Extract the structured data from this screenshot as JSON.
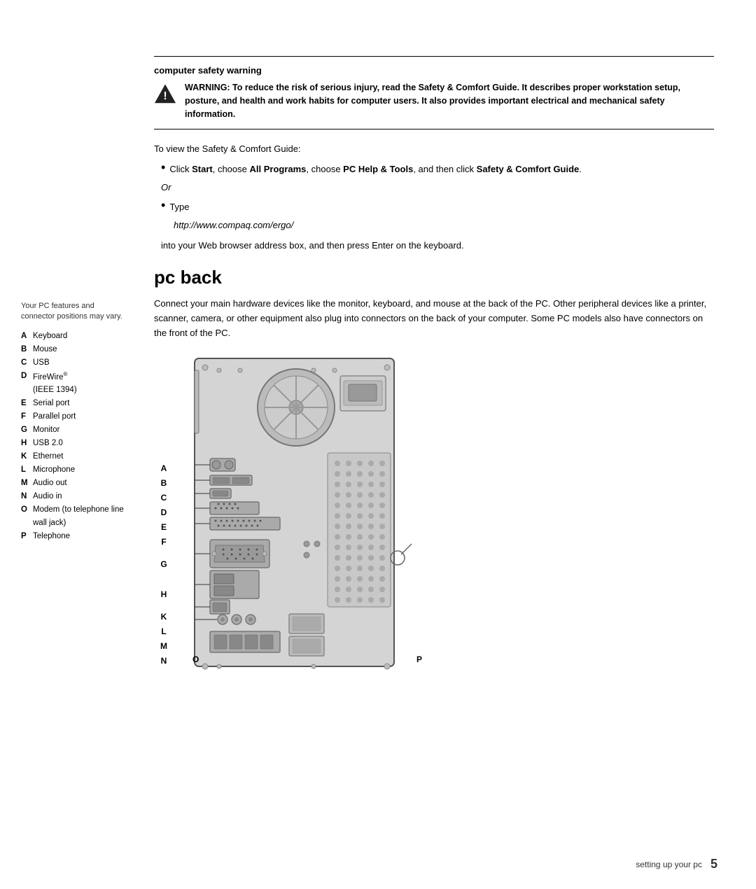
{
  "page": {
    "footer_text": "setting up your pc",
    "page_number": "5"
  },
  "warning": {
    "title": "computer safety warning",
    "icon_alt": "warning-triangle",
    "text": "WARNING: To reduce the risk of serious injury, read the Safety & Comfort Guide. It describes proper workstation setup, posture, and health and work habits for computer users. It also provides important electrical and mechanical safety information."
  },
  "safety_guide": {
    "intro": "To view the Safety & Comfort Guide:",
    "bullet1_prefix": "Click ",
    "bullet1_start": "Start",
    "bullet1_middle1": ", choose ",
    "bullet1_all_programs": "All Programs",
    "bullet1_middle2": ", choose ",
    "bullet1_pc_help": "PC Help & Tools",
    "bullet1_end": ", and then click ",
    "bullet1_safety": "Safety & Comfort Guide",
    "bullet1_end2": ".",
    "or_text": "Or",
    "bullet2_prefix": "Type",
    "url": "http://www.compaq.com/ergo/",
    "into_text": "into your Web browser address box, and then press Enter on the keyboard."
  },
  "pc_back": {
    "heading": "pc back",
    "description": "Connect your main hardware devices like the monitor, keyboard, and mouse at the back of the PC. Other peripheral devices like a printer, scanner, camera, or other equipment also plug into connectors on the back of your computer. Some PC models also have connectors on the front of the PC."
  },
  "sidebar": {
    "intro": "Your PC features and connector positions may vary.",
    "items": [
      {
        "letter": "A",
        "text": "Keyboard"
      },
      {
        "letter": "B",
        "text": "Mouse"
      },
      {
        "letter": "C",
        "text": "USB"
      },
      {
        "letter": "D",
        "text": "FireWire® (IEEE 1394)"
      },
      {
        "letter": "E",
        "text": "Serial port"
      },
      {
        "letter": "F",
        "text": "Parallel port"
      },
      {
        "letter": "G",
        "text": "Monitor"
      },
      {
        "letter": "H",
        "text": "USB 2.0"
      },
      {
        "letter": "K",
        "text": "Ethernet"
      },
      {
        "letter": "L",
        "text": "Microphone"
      },
      {
        "letter": "M",
        "text": "Audio out"
      },
      {
        "letter": "N",
        "text": "Audio in"
      },
      {
        "letter": "O",
        "text": "Modem (to telephone line wall jack)"
      },
      {
        "letter": "P",
        "text": "Telephone"
      }
    ]
  },
  "diagram": {
    "labels_left": [
      "A",
      "B",
      "C",
      "D",
      "E",
      "F",
      "G",
      "H",
      "K",
      "L",
      "M",
      "N"
    ],
    "label_o": "O",
    "label_p": "P"
  }
}
